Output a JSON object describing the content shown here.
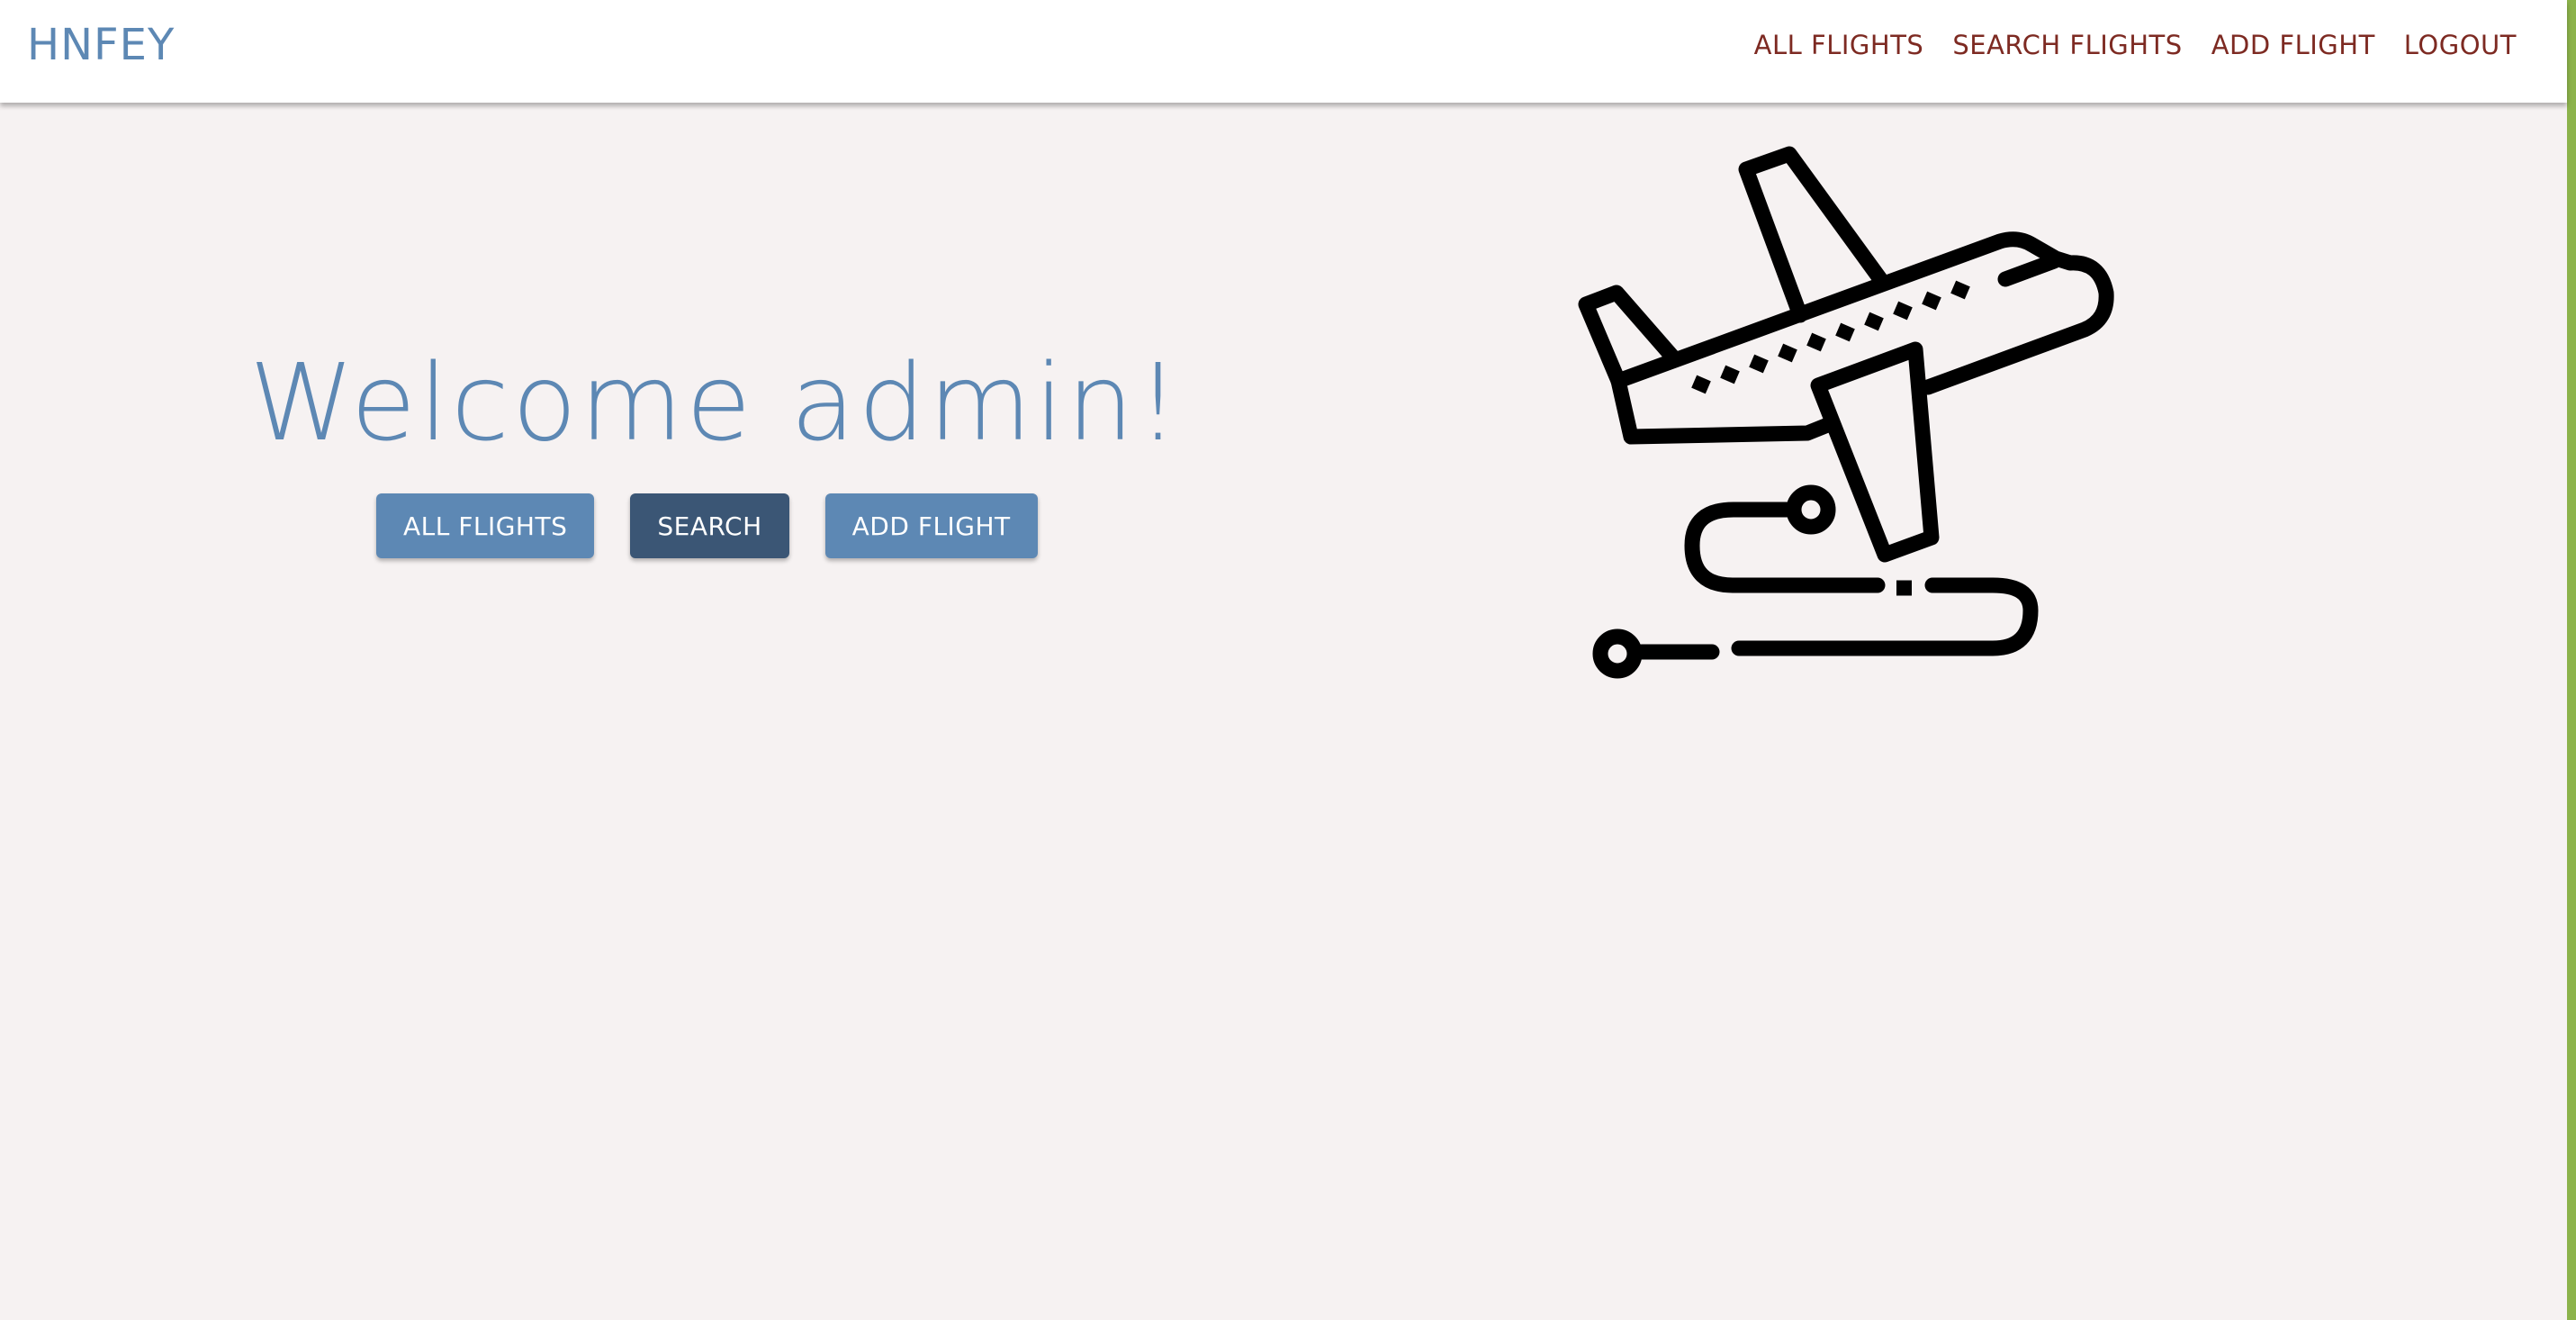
{
  "navbar": {
    "brand": "HNFEY",
    "links": [
      "ALL FLIGHTS",
      "SEARCH FLIGHTS",
      "ADD FLIGHT",
      "LOGOUT"
    ]
  },
  "hero": {
    "welcome": "Welcome admin!",
    "buttons": [
      "ALL FLIGHTS",
      "SEARCH",
      "ADD FLIGHT"
    ],
    "active_button": "SEARCH"
  },
  "illustration": {
    "icon": "airplane-takeoff-icon"
  },
  "colors": {
    "brand": "#5d88b4",
    "nav_link": "#7d2a22",
    "button": "#5d88b4",
    "button_active": "#3b5675",
    "background": "#f6f2f2",
    "accent_bar": "#8cb34b"
  }
}
